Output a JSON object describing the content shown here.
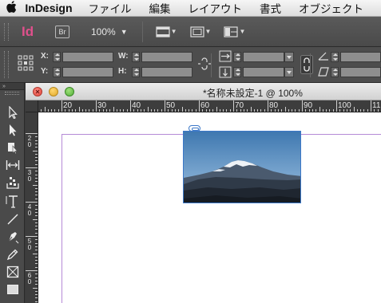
{
  "menubar": {
    "apple_icon": "apple-logo-icon",
    "app_name": "InDesign",
    "items": [
      "ファイル",
      "編集",
      "レイアウト",
      "書式",
      "オブジェクト"
    ]
  },
  "appbar": {
    "app_icon_text": "Id",
    "bridge_label": "Br",
    "zoom": "100%"
  },
  "controlpanel": {
    "x_label": "X:",
    "y_label": "Y:",
    "w_label": "W:",
    "h_label": "H:"
  },
  "tools_panel": {
    "collapse_glyph": "»",
    "tools": [
      "selection-tool",
      "direct-selection-tool",
      "page-tool",
      "gap-tool",
      "content-collector-tool",
      "type-tool",
      "line-tool",
      "pen-tool",
      "pencil-tool",
      "rectangle-frame-tool",
      "rectangle-tool"
    ]
  },
  "document": {
    "title": "*名称未設定-1 @ 100%",
    "ruler_h_labels": [
      "20",
      "30",
      "40",
      "50",
      "60",
      "70",
      "80",
      "90",
      "100",
      "11"
    ],
    "ruler_v_labels": [
      "2\n0",
      "3\n0",
      "4\n0",
      "5\n0",
      "6\n0"
    ]
  },
  "colors": {
    "accent": "#3c78c8",
    "margin_guide": "#b58ad6",
    "indesign_pink": "#e0508c"
  }
}
